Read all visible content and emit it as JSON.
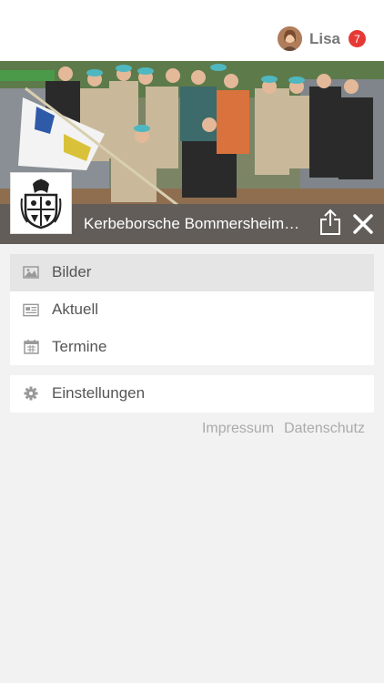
{
  "header": {
    "user_name": "Lisa",
    "notification_count": "7",
    "badge_color": "#e53935"
  },
  "hero": {
    "club_name": "Kerbeborsche Bommersheim…",
    "share_icon": "share-icon",
    "close_icon": "close-icon"
  },
  "menu": {
    "items": [
      {
        "label": "Bilder",
        "icon": "image-icon",
        "active": true
      },
      {
        "label": "Aktuell",
        "icon": "newspaper-icon",
        "active": false
      },
      {
        "label": "Termine",
        "icon": "calendar-icon",
        "active": false
      }
    ],
    "settings": {
      "label": "Einstellungen",
      "icon": "gear-icon"
    }
  },
  "footer": {
    "links": [
      "Impressum",
      "Datenschutz"
    ]
  }
}
